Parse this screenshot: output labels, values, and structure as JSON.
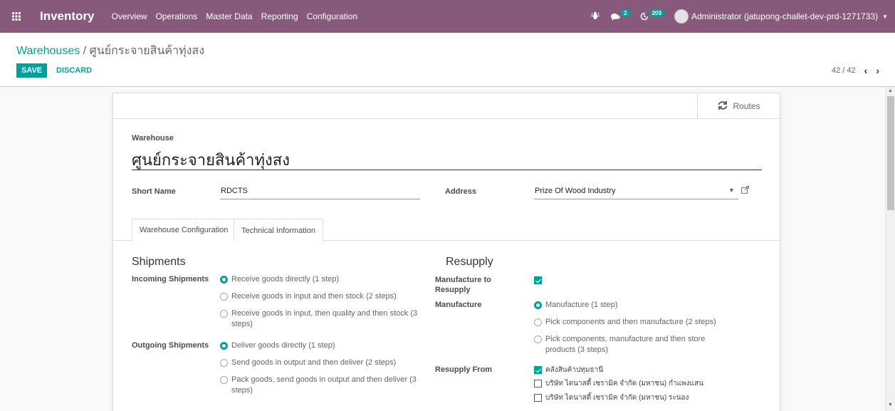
{
  "navbar": {
    "app_name": "Inventory",
    "menu": [
      "Overview",
      "Operations",
      "Master Data",
      "Reporting",
      "Configuration"
    ],
    "messages_count": "2",
    "activities_count": "209",
    "user": "Administrator (jatupong-challet-dev-prd-1271733)"
  },
  "breadcrumb": {
    "parent": "Warehouses",
    "separator": "/",
    "current": "ศูนย์กระจายสินค้าทุ่งสง"
  },
  "buttons": {
    "save": "SAVE",
    "discard": "DISCARD"
  },
  "pager": {
    "value": "42 / 42"
  },
  "buttonbox": {
    "routes": "Routes"
  },
  "form": {
    "warehouse_label": "Warehouse",
    "warehouse_name": "ศูนย์กระจายสินค้าทุ่งสง",
    "short_name_label": "Short Name",
    "short_name": "RDCTS",
    "address_label": "Address",
    "address": "Prize Of Wood Industry"
  },
  "tabs": [
    "Warehouse Configuration",
    "Technical Information"
  ],
  "shipments": {
    "title": "Shipments",
    "incoming_label": "Incoming Shipments",
    "incoming_options": [
      {
        "label": "Receive goods directly (1 step)",
        "checked": true
      },
      {
        "label": "Receive goods in input and then stock (2 steps)",
        "checked": false
      },
      {
        "label": "Receive goods in input, then quality and then stock (3 steps)",
        "checked": false
      }
    ],
    "outgoing_label": "Outgoing Shipments",
    "outgoing_options": [
      {
        "label": "Deliver goods directly (1 step)",
        "checked": true
      },
      {
        "label": "Send goods in output and then deliver (2 steps)",
        "checked": false
      },
      {
        "label": "Pack goods, send goods in output and then deliver (3 steps)",
        "checked": false
      }
    ]
  },
  "resupply": {
    "title": "Resupply",
    "manufacture_to_resupply_label": "Manufacture to Resupply",
    "manufacture_to_resupply": true,
    "manufacture_label": "Manufacture",
    "manufacture_options": [
      {
        "label": "Manufacture (1 step)",
        "checked": true
      },
      {
        "label": "Pick components and then manufacture (2 steps)",
        "checked": false
      },
      {
        "label": "Pick components, manufacture and then store products (3 steps)",
        "checked": false
      }
    ],
    "resupply_from_label": "Resupply From",
    "resupply_from": [
      {
        "label": "คลังสินค้าปทุมธานี",
        "checked": true
      },
      {
        "label": "บริษัท ไดนาสตี้ เซรามิค จำกัด (มหาชน) กำแพงแสน",
        "checked": false
      },
      {
        "label": "บริษัท ไดนาสตี้ เซรามิค จำกัด (มหาชน) ระนอง",
        "checked": false
      }
    ]
  },
  "colors": {
    "navbar": "#875a7b",
    "accent": "#00a09d"
  }
}
